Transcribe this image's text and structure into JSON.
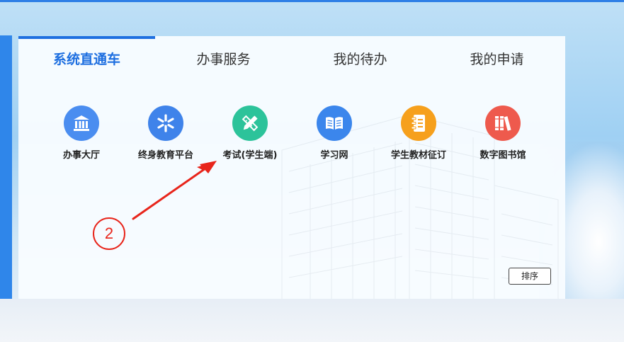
{
  "tabs": [
    {
      "label": "系统直通车",
      "active": true
    },
    {
      "label": "办事服务",
      "active": false
    },
    {
      "label": "我的待办",
      "active": false
    },
    {
      "label": "我的申请",
      "active": false
    }
  ],
  "apps": [
    {
      "label": "办事大厅",
      "icon": "bank-icon",
      "color": "#4a8df0"
    },
    {
      "label": "终身教育平台",
      "icon": "asterisk-icon",
      "color": "#3f83ea"
    },
    {
      "label": "考试(学生端)",
      "icon": "pencil-ruler-icon",
      "color": "#2cc39a"
    },
    {
      "label": "学习网",
      "icon": "open-book-icon",
      "color": "#3b86ec"
    },
    {
      "label": "学生教材征订",
      "icon": "notebook-icon",
      "color": "#f6a01c"
    },
    {
      "label": "数字图书馆",
      "icon": "books-icon",
      "color": "#ee5a4d"
    }
  ],
  "sort_button": "排序",
  "annotation": {
    "step_number": "2",
    "color": "#e8251b"
  },
  "colors": {
    "accent": "#1e6fe0",
    "side_bar": "#2f86ea"
  }
}
